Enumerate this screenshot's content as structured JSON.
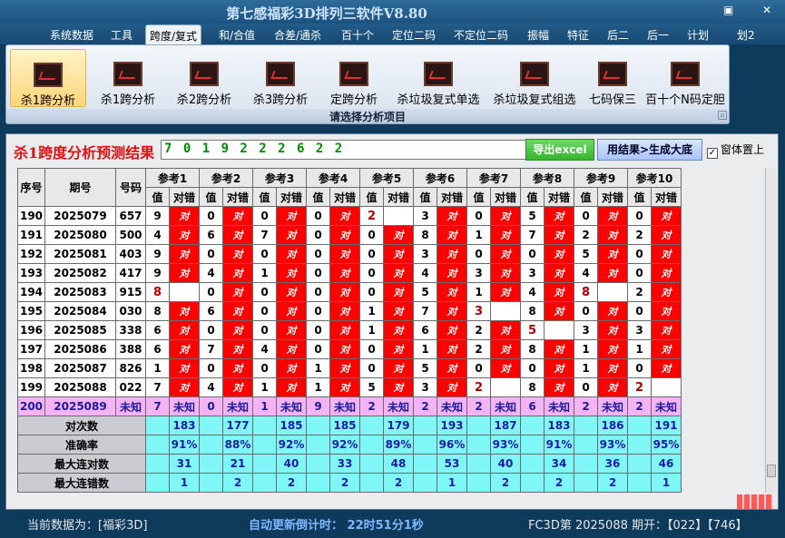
{
  "window": {
    "title": "第七感福彩3D排列三软件V8.80",
    "restore_glyph": "▣",
    "close_glyph": "✕"
  },
  "menu": [
    "系统数据",
    "工具",
    "跨度/复式",
    "和/合值",
    "合差/通杀",
    "百十个",
    "定位二码",
    "不定位二码",
    "振幅",
    "特征",
    "后二",
    "后一",
    "计划",
    "划2"
  ],
  "ribbon": {
    "buttons": [
      "杀1跨分析",
      "杀1跨分析",
      "杀2跨分析",
      "杀3跨分析",
      "定跨分析",
      "杀垃圾复式单选",
      "杀垃圾复式组选",
      "七码保三",
      "百十个N码定胆"
    ],
    "caption": "请选择分析项目",
    "corner_glyph": "▫"
  },
  "panel": {
    "result_label": "杀1跨度分析预测结果",
    "result_value": "7 0 1 9 2 2 2 6 2 2",
    "excel_button": "导出excel",
    "result_button": "用结果>生成大底",
    "checkbox_mark": "✓",
    "checkbox_label": "窗体置上"
  },
  "table": {
    "col_seq": "序号",
    "col_period": "期号",
    "col_code": "号码",
    "refs": [
      "参考1",
      "参考2",
      "参考3",
      "参考4",
      "参考5",
      "参考6",
      "参考7",
      "参考8",
      "参考9",
      "参考10"
    ],
    "sub_value": "值",
    "sub_hit": "对错",
    "hit_mark": "对",
    "rows": [
      {
        "seq": "190",
        "period": "2025079",
        "code": "657",
        "vals": [
          "9",
          "0",
          "0",
          "0",
          "2",
          "3",
          "0",
          "5",
          "0",
          "0"
        ],
        "hits": [
          1,
          1,
          1,
          1,
          0,
          1,
          1,
          1,
          1,
          1
        ]
      },
      {
        "seq": "191",
        "period": "2025080",
        "code": "500",
        "vals": [
          "4",
          "6",
          "7",
          "0",
          "0",
          "8",
          "1",
          "7",
          "2",
          "2"
        ],
        "hits": [
          1,
          1,
          1,
          1,
          1,
          1,
          1,
          1,
          1,
          1
        ]
      },
      {
        "seq": "192",
        "period": "2025081",
        "code": "403",
        "vals": [
          "9",
          "0",
          "0",
          "0",
          "0",
          "3",
          "0",
          "0",
          "5",
          "0"
        ],
        "hits": [
          1,
          1,
          1,
          1,
          1,
          1,
          1,
          1,
          1,
          1
        ]
      },
      {
        "seq": "193",
        "period": "2025082",
        "code": "417",
        "vals": [
          "9",
          "4",
          "1",
          "0",
          "0",
          "4",
          "3",
          "3",
          "4",
          "0"
        ],
        "hits": [
          1,
          1,
          1,
          1,
          1,
          1,
          1,
          1,
          1,
          1
        ]
      },
      {
        "seq": "194",
        "period": "2025083",
        "code": "915",
        "vals": [
          "8",
          "0",
          "0",
          "0",
          "0",
          "5",
          "1",
          "4",
          "8",
          "2"
        ],
        "hits": [
          0,
          1,
          1,
          1,
          1,
          1,
          1,
          1,
          0,
          1
        ]
      },
      {
        "seq": "195",
        "period": "2025084",
        "code": "030",
        "vals": [
          "8",
          "6",
          "0",
          "0",
          "1",
          "7",
          "3",
          "8",
          "0",
          "0"
        ],
        "hits": [
          1,
          1,
          1,
          1,
          1,
          1,
          0,
          1,
          1,
          1
        ]
      },
      {
        "seq": "196",
        "period": "2025085",
        "code": "338",
        "vals": [
          "6",
          "0",
          "0",
          "0",
          "1",
          "6",
          "2",
          "5",
          "3",
          "3"
        ],
        "hits": [
          1,
          1,
          1,
          1,
          1,
          1,
          1,
          0,
          1,
          1
        ]
      },
      {
        "seq": "197",
        "period": "2025086",
        "code": "388",
        "vals": [
          "6",
          "7",
          "4",
          "0",
          "0",
          "1",
          "2",
          "8",
          "1",
          "1"
        ],
        "hits": [
          1,
          1,
          1,
          1,
          1,
          1,
          1,
          1,
          1,
          1
        ]
      },
      {
        "seq": "198",
        "period": "2025087",
        "code": "826",
        "vals": [
          "1",
          "0",
          "0",
          "1",
          "0",
          "5",
          "0",
          "0",
          "1",
          "0"
        ],
        "hits": [
          1,
          1,
          1,
          1,
          1,
          1,
          1,
          1,
          1,
          1
        ]
      },
      {
        "seq": "199",
        "period": "2025088",
        "code": "022",
        "vals": [
          "7",
          "4",
          "1",
          "1",
          "5",
          "3",
          "2",
          "8",
          "0",
          "2"
        ],
        "hits": [
          1,
          1,
          1,
          1,
          1,
          1,
          0,
          1,
          1,
          0
        ]
      }
    ],
    "unknown_row": {
      "seq": "200",
      "period": "2025089",
      "code": "未知",
      "vals": [
        "7",
        "0",
        "1",
        "9",
        "2",
        "2",
        "2",
        "6",
        "2",
        "2"
      ],
      "hit": "未知"
    },
    "summary": [
      {
        "label": "对次数",
        "vals": [
          "183",
          "177",
          "185",
          "185",
          "179",
          "193",
          "187",
          "183",
          "186",
          "191"
        ]
      },
      {
        "label": "准确率",
        "vals": [
          "91%",
          "88%",
          "92%",
          "92%",
          "89%",
          "96%",
          "93%",
          "91%",
          "93%",
          "95%"
        ]
      },
      {
        "label": "最大连对数",
        "vals": [
          "31",
          "21",
          "40",
          "33",
          "48",
          "53",
          "40",
          "34",
          "36",
          "46"
        ]
      },
      {
        "label": "最大连错数",
        "vals": [
          "1",
          "2",
          "2",
          "2",
          "2",
          "1",
          "2",
          "2",
          "2",
          "1"
        ]
      }
    ]
  },
  "status": {
    "data_source": "当前数据为：[福彩3D]",
    "countdown": "自动更新倒计时：  22时51分1秒",
    "draw_info": "FC3D第 2025088 期开：【022】【746】"
  },
  "colors": {
    "hit": "#ff0000",
    "unknown_row": "#f4b3f4",
    "summary": "#7ff7f7",
    "title_text": "#cfe3ff",
    "result_label": "#e01010"
  }
}
